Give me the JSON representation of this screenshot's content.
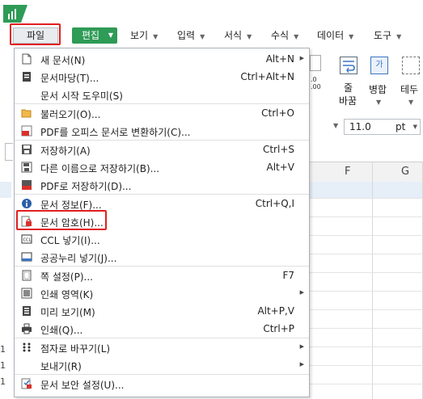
{
  "menubar": {
    "tabs": [
      {
        "label": "파일"
      },
      {
        "label": "편집"
      },
      {
        "label": "보기"
      },
      {
        "label": "입력"
      },
      {
        "label": "서식"
      },
      {
        "label": "수식"
      },
      {
        "label": "데이터"
      },
      {
        "label": "도구"
      }
    ]
  },
  "ribbon": {
    "decimal_label": ".0\n.00",
    "wrap_label_1": "줄",
    "wrap_label_2": "바꿈",
    "merge_label": "병합",
    "border_label": "테두",
    "merge_icon_text": "가"
  },
  "font": {
    "size_value": "11.0",
    "size_unit": "pt"
  },
  "grid": {
    "columns": [
      "F",
      "G"
    ]
  },
  "file_menu": {
    "items": [
      {
        "icon": "new-doc-icon",
        "label": "새 문서(N)",
        "shortcut": "Alt+N",
        "submenu": true
      },
      {
        "icon": "doc-yard-icon",
        "label": "문서마당(T)...",
        "shortcut": "Ctrl+Alt+N",
        "submenu": false
      },
      {
        "icon": "",
        "label": "문서 시작 도우미(S)",
        "shortcut": "",
        "submenu": false
      },
      {
        "icon": "folder-open-icon",
        "label": "불러오기(O)...",
        "shortcut": "Ctrl+O",
        "submenu": false
      },
      {
        "icon": "pdf-convert-icon",
        "label": "PDF를 오피스 문서로 변환하기(C)...",
        "shortcut": "",
        "submenu": false
      },
      {
        "icon": "save-icon",
        "label": "저장하기(A)",
        "shortcut": "Ctrl+S",
        "submenu": false
      },
      {
        "icon": "save-as-icon",
        "label": "다른 이름으로 저장하기(B)...",
        "shortcut": "Alt+V",
        "submenu": false
      },
      {
        "icon": "pdf-save-icon",
        "label": "PDF로 저장하기(D)...",
        "shortcut": "",
        "submenu": false
      },
      {
        "icon": "info-icon",
        "label": "문서 정보(F)...",
        "shortcut": "Ctrl+Q,I",
        "submenu": false
      },
      {
        "icon": "doc-password-icon",
        "label": "문서 암호(H)...",
        "shortcut": "",
        "submenu": false
      },
      {
        "icon": "ccl-icon",
        "label": "CCL 넣기(I)...",
        "shortcut": "",
        "submenu": false
      },
      {
        "icon": "open-license-icon",
        "label": "공공누리 넣기(J)...",
        "shortcut": "",
        "submenu": false
      },
      {
        "icon": "page-setup-icon",
        "label": "쪽 설정(P)...",
        "shortcut": "F7",
        "submenu": false
      },
      {
        "icon": "print-area-icon",
        "label": "인쇄 영역(K)",
        "shortcut": "",
        "submenu": true
      },
      {
        "icon": "print-preview-icon",
        "label": "미리 보기(M)",
        "shortcut": "Alt+P,V",
        "submenu": false
      },
      {
        "icon": "print-icon",
        "label": "인쇄(Q)...",
        "shortcut": "Ctrl+P",
        "submenu": false
      },
      {
        "icon": "braille-icon",
        "label": "점자로 바꾸기(L)",
        "shortcut": "",
        "submenu": true
      },
      {
        "icon": "",
        "label": "보내기(R)",
        "shortcut": "",
        "submenu": true
      },
      {
        "icon": "security-settings-icon",
        "label": "문서 보안 설정(U)...",
        "shortcut": "",
        "submenu": false
      }
    ]
  },
  "left_rows": [
    "1",
    "1",
    "1"
  ],
  "colors": {
    "edit_tab_bg": "#2e9b56",
    "highlight": "#e02020",
    "menu_border": "#a9b1b8"
  }
}
